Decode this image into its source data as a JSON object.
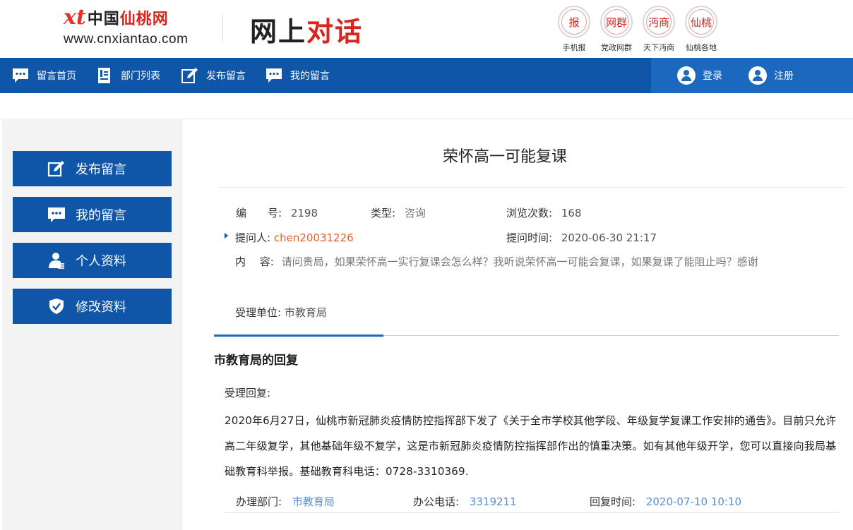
{
  "header": {
    "logo_mark": "xt",
    "logo_name_black": "中国",
    "logo_name_red": "仙桃网",
    "logo_url": "www.cnxiantao.com",
    "site_title_black": "网上",
    "site_title_red": "对话",
    "quick_links": [
      {
        "circle": "报",
        "label": "手机报"
      },
      {
        "circle": "网群",
        "label": "党政网群"
      },
      {
        "circle": "沔商",
        "label": "天下沔商"
      },
      {
        "circle": "仙桃",
        "label": "仙桃各地"
      }
    ]
  },
  "nav": {
    "items": [
      {
        "label": "留言首页",
        "icon": "chat-icon"
      },
      {
        "label": "部门列表",
        "icon": "list-icon"
      },
      {
        "label": "发布留言",
        "icon": "edit-icon"
      },
      {
        "label": "我的留言",
        "icon": "chat-icon"
      }
    ],
    "login": "登录",
    "register": "注册"
  },
  "sidebar": {
    "items": [
      {
        "label": "发布留言",
        "icon": "edit-icon"
      },
      {
        "label": "我的留言",
        "icon": "chat-icon"
      },
      {
        "label": "个人资料",
        "icon": "user-icon"
      },
      {
        "label": "修改资料",
        "icon": "shield-icon"
      }
    ]
  },
  "message": {
    "title": "荣怀高一可能复课",
    "number_label": "编　　号:",
    "number": "2198",
    "type_label": "类型:",
    "type": "咨询",
    "views_label": "浏览次数:",
    "views": "168",
    "asker_label": "提问人:",
    "asker": "chen20031226",
    "time_label": "提问时间:",
    "time": "2020-06-30 21:17",
    "content_label": "内　 容:",
    "content": "请问贵局，如果荣怀高一实行复课会怎么样？我听说荣怀高一可能会复课，如果复课了能阻止吗？感谢",
    "unit_label": "受理单位:",
    "unit": "市教育局"
  },
  "reply": {
    "title": "市教育局的回复",
    "label": "受理回复:",
    "body": "2020年6月27日，仙桃市新冠肺炎疫情防控指挥部下发了《关于全市学校其他学段、年级复学复课工作安排的通告》。目前只允许高二年级复学，其他基础年级不复学，这是市新冠肺炎疫情防控指挥部作出的慎重决策。如有其他年级开学，您可以直接向我局基础教育科举报。基础教育科电话：0728-3310369.",
    "dept_label": "办理部门:",
    "dept": "市教育局",
    "phone_label": "办公电话:",
    "phone": "3319211",
    "reply_time_label": "回复时间:",
    "reply_time": "2020-07-10 10:10"
  },
  "colors": {
    "nav_blue": "#0f55a8",
    "nav_blue_light": "#1b68be",
    "accent_red": "#d9251c",
    "asker_orange": "#e4622a",
    "link_blue": "#5b8fce"
  }
}
